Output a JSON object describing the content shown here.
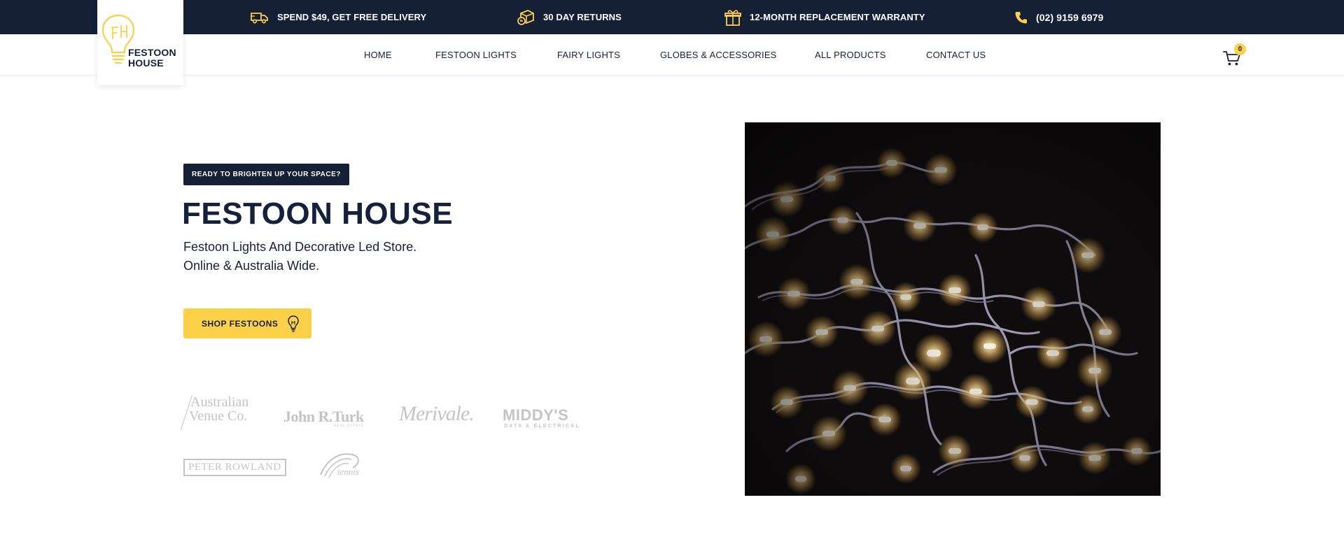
{
  "topbar": {
    "items": [
      {
        "label": "SPEND $49, GET FREE DELIVERY",
        "icon": "truck-icon"
      },
      {
        "label": "30 DAY RETURNS",
        "icon": "return-box-icon"
      },
      {
        "label": "12-MONTH REPLACEMENT WARRANTY",
        "icon": "gift-icon"
      },
      {
        "label": "(02) 9159 6979",
        "icon": "phone-icon"
      }
    ]
  },
  "logo": {
    "line1": "FESTOON",
    "line2": "HOUSE"
  },
  "nav": {
    "links": [
      "HOME",
      "FESTOON LIGHTS",
      "FAIRY LIGHTS",
      "GLOBES & ACCESSORIES",
      "ALL PRODUCTS",
      "CONTACT US"
    ],
    "cart_count": "0"
  },
  "hero": {
    "badge": "READY TO BRIGHTEN UP YOUR SPACE?",
    "title": "FESTOON HOUSE",
    "subtitle_line1": "Festoon Lights And Decorative Led Store.",
    "subtitle_line2": "Online & Australia Wide.",
    "cta": "SHOP FESTOONS"
  },
  "partners": {
    "avc_line1": "Australian",
    "avc_line2": "Venue Co.",
    "jrt": "John R.Turk",
    "jrt_sub": "REAL ESTATE",
    "meriton": "Merivale.",
    "middys": "MIDDY'S",
    "middys_sub": "DATA & ELECTRICAL",
    "peter_rowland": "PETER ROWLAND",
    "tennis": "tennis"
  },
  "colors": {
    "navy": "#152036",
    "accent": "#fdd04a",
    "partner_grey": "#c4c4c4"
  }
}
